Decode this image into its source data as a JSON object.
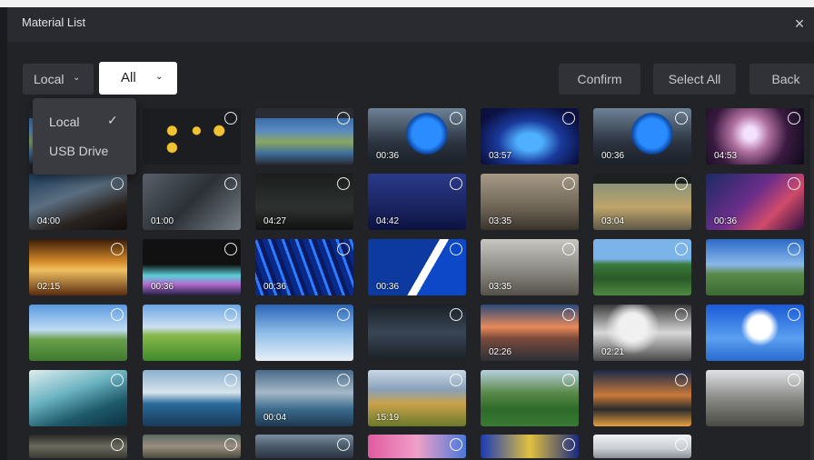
{
  "window": {
    "title": "Material List",
    "close_glyph": "×"
  },
  "toolbar": {
    "source": {
      "value": "Local",
      "chevron": "⌄"
    },
    "type_filter": {
      "value": "All",
      "chevron": "⌄"
    },
    "buttons": [
      {
        "id": "confirm",
        "label": "Confirm"
      },
      {
        "id": "select-all",
        "label": "Select All"
      },
      {
        "id": "back",
        "label": "Back"
      }
    ]
  },
  "source_dropdown": {
    "items": [
      {
        "label": "Local",
        "selected": true,
        "check": "✓"
      },
      {
        "label": "USB Drive",
        "selected": false
      }
    ]
  },
  "thumbnails": [
    {
      "style": "folders-blue",
      "duration": ""
    },
    {
      "style": "folders-yellow",
      "duration": ""
    },
    {
      "style": "folders-blue",
      "duration": ""
    },
    {
      "style": "globe",
      "duration": "00:36"
    },
    {
      "style": "stage",
      "duration": "03:57"
    },
    {
      "style": "globe",
      "duration": "00:36"
    },
    {
      "style": "nebula",
      "duration": "04:53"
    },
    {
      "style": "street",
      "duration": "04:00"
    },
    {
      "style": "city",
      "duration": "01:00"
    },
    {
      "style": "dark",
      "duration": "04:27"
    },
    {
      "style": "news",
      "duration": "04:42"
    },
    {
      "style": "room",
      "duration": "03:35"
    },
    {
      "style": "meeting",
      "duration": "03:04"
    },
    {
      "style": "purple",
      "duration": "00:36"
    },
    {
      "style": "gold",
      "duration": "02:15"
    },
    {
      "style": "teal",
      "duration": "00:36"
    },
    {
      "style": "blue-lines",
      "duration": "00:36"
    },
    {
      "style": "blue-logo",
      "duration": "00:36"
    },
    {
      "style": "port",
      "duration": "03:35"
    },
    {
      "style": "valley",
      "duration": ""
    },
    {
      "style": "mountain-sky",
      "duration": ""
    },
    {
      "style": "hut",
      "duration": ""
    },
    {
      "style": "field",
      "duration": ""
    },
    {
      "style": "clouds",
      "duration": ""
    },
    {
      "style": "night-city",
      "duration": ""
    },
    {
      "style": "sunset-peaks",
      "duration": "02:26"
    },
    {
      "style": "blossom",
      "duration": "02:21"
    },
    {
      "style": "blue-sky",
      "duration": ""
    },
    {
      "style": "wave",
      "duration": ""
    },
    {
      "style": "harbor",
      "duration": ""
    },
    {
      "style": "alpine-lake",
      "duration": "00:04"
    },
    {
      "style": "meadow",
      "duration": "15:19"
    },
    {
      "style": "green-hills",
      "duration": ""
    },
    {
      "style": "dusk-city",
      "duration": ""
    },
    {
      "style": "rocks",
      "duration": ""
    },
    {
      "style": "cliffs",
      "duration": ""
    },
    {
      "style": "forest",
      "duration": ""
    },
    {
      "style": "lake",
      "duration": ""
    },
    {
      "style": "pink",
      "duration": ""
    },
    {
      "style": "colorful",
      "duration": ""
    },
    {
      "style": "snow",
      "duration": ""
    }
  ],
  "icons": {
    "close": "close-icon",
    "check": "check-icon",
    "chevron": "chevron-down-icon",
    "radio": "select-circle-icon"
  }
}
